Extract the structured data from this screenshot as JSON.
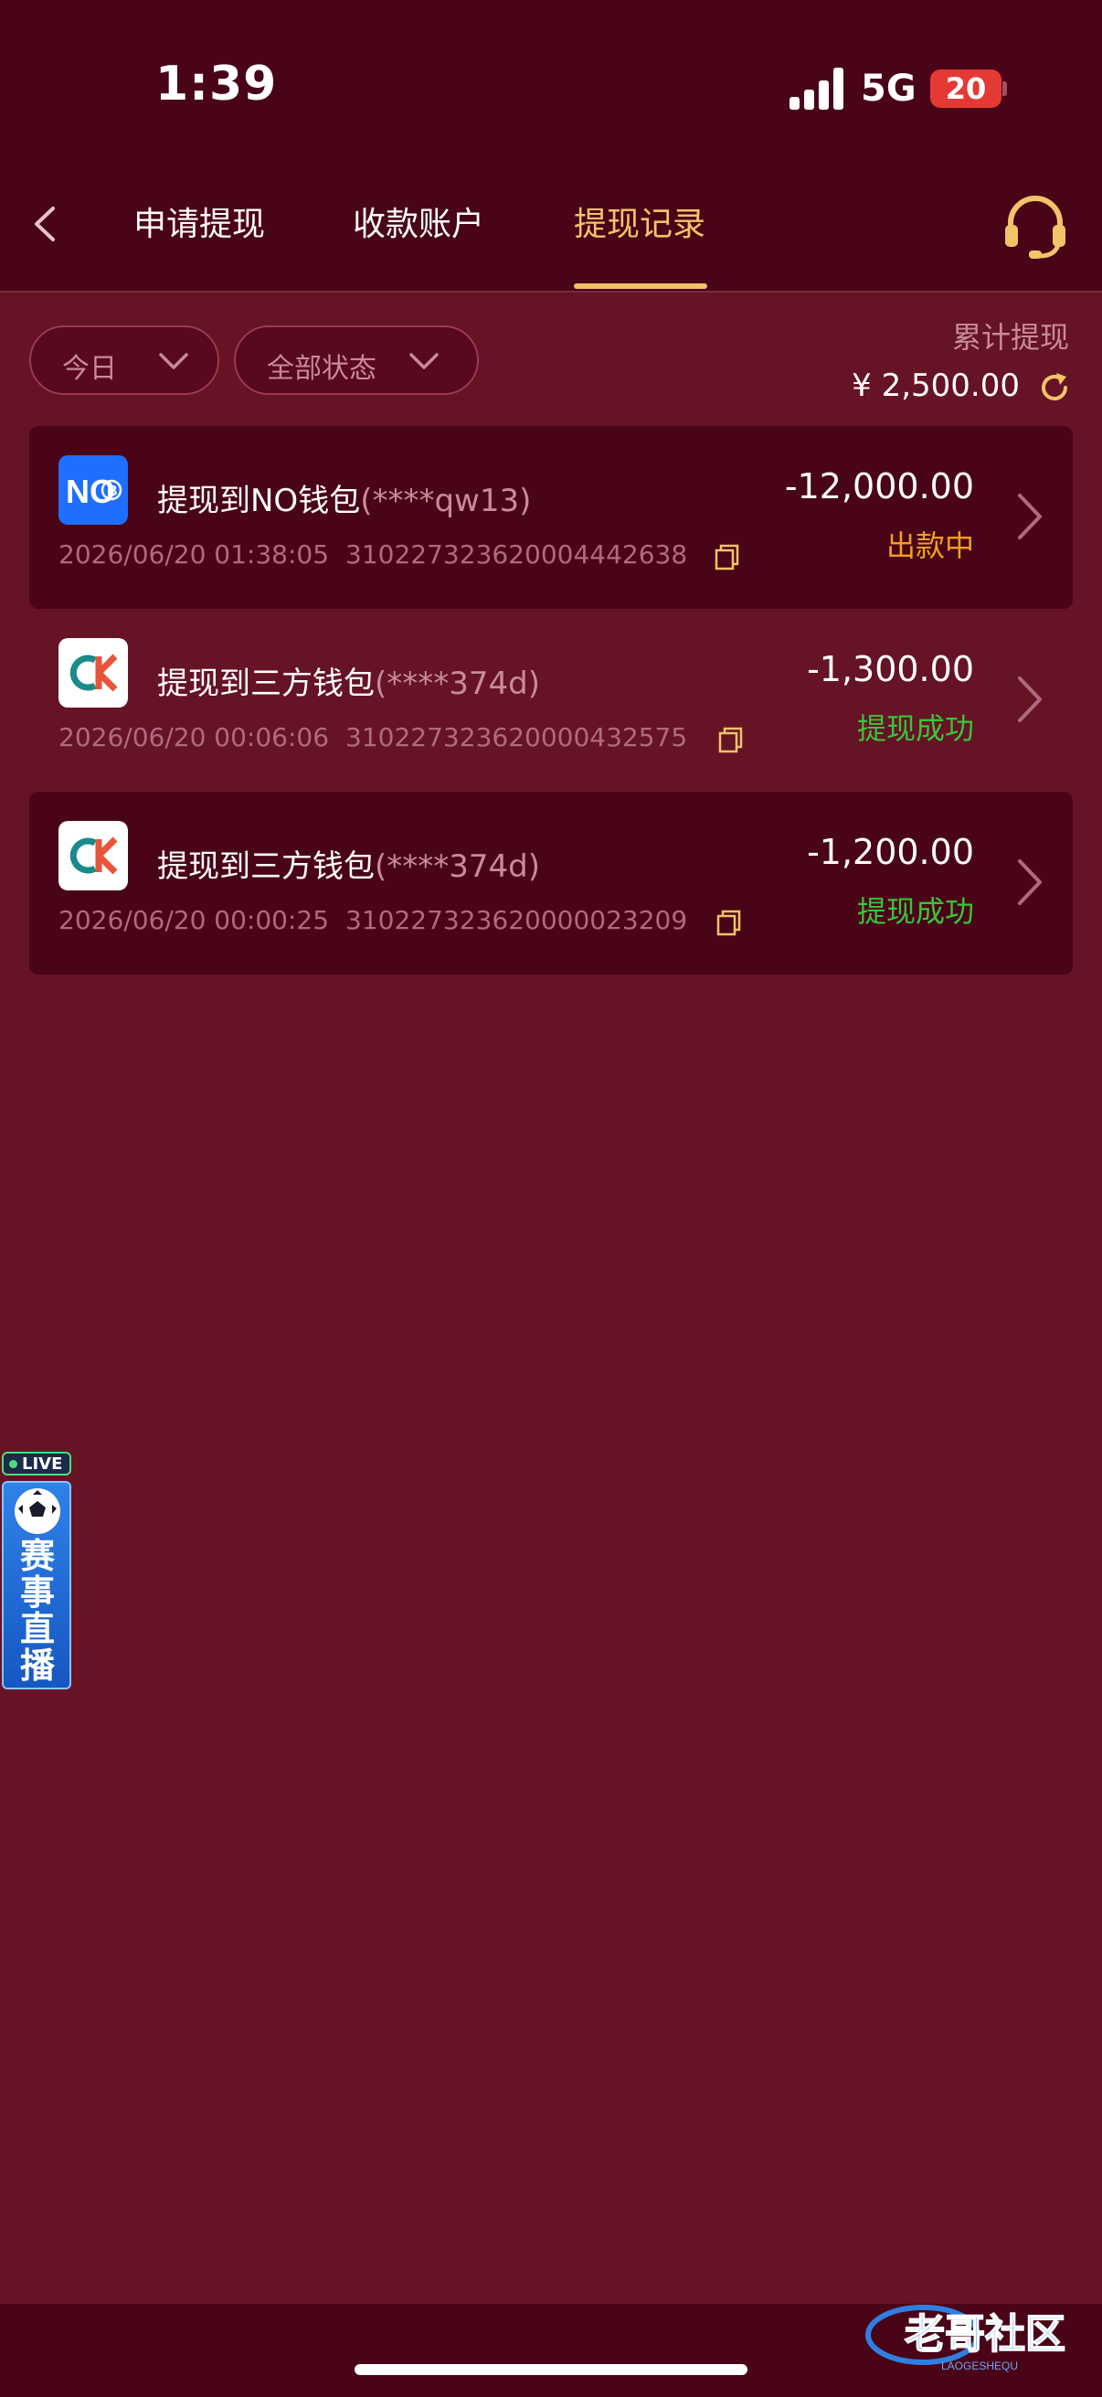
{
  "status_bar": {
    "time": "1:39",
    "network": "5G",
    "battery": "20"
  },
  "nav": {
    "tabs": [
      {
        "label": "申请提现"
      },
      {
        "label": "收款账户"
      },
      {
        "label": "提现记录"
      }
    ],
    "active_tab": "提现记录"
  },
  "filters": {
    "date": "今日",
    "status": "全部状态"
  },
  "summary": {
    "label": "累计提现",
    "amount": "¥ 2,500.00"
  },
  "records": [
    {
      "logo": "NO",
      "title": "提现到NO钱包",
      "account_mask": "(****qw13)",
      "datetime": "2026/06/20 01:38:05",
      "order_id": "310227323620004442638",
      "amount": "-12,000.00",
      "status": "出款中"
    },
    {
      "logo": "CK",
      "title": "提现到三方钱包",
      "account_mask": "(****374d)",
      "datetime": "2026/06/20 00:06:06",
      "order_id": "310227323620000432575",
      "amount": "-1,300.00",
      "status": "提现成功"
    },
    {
      "logo": "CK",
      "title": "提现到三方钱包",
      "account_mask": "(****374d)",
      "datetime": "2026/06/20 00:00:25",
      "order_id": "310227323620000023209",
      "amount": "-1,200.00",
      "status": "提现成功"
    }
  ],
  "live_widget": {
    "badge": "LIVE",
    "text": "赛事直播"
  },
  "watermark": {
    "text": "老哥社区",
    "subtext": "LAOGESHEQU"
  },
  "colors": {
    "accent": "#f2c46a",
    "pending": "#f0a020",
    "success": "#39c43a",
    "background": "#661326",
    "header": "#4a0418"
  }
}
